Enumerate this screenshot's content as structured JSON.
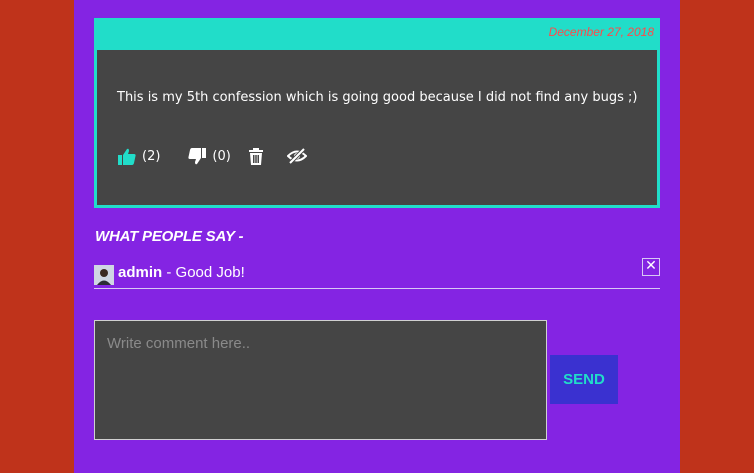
{
  "colors": {
    "page_bg": "#bf331b",
    "panel_bg": "#8424e3",
    "card_accent": "#21ddc9",
    "card_body": "#454545",
    "date_text": "#ff4a4a",
    "send_bg": "#3a31d0"
  },
  "confession": {
    "date": "December 27, 2018",
    "text": "This is my 5th confession which is going good because I did not find any bugs ;)",
    "likes": "(2)",
    "dislikes": "(0)",
    "icons": [
      "thumbs-up-icon",
      "thumbs-down-icon",
      "trash-icon",
      "eye-slash-icon"
    ]
  },
  "comments_section": {
    "title": "WHAT PEOPLE SAY -",
    "comments": [
      {
        "author": "admin",
        "separator": " - ",
        "text": "Good Job!"
      }
    ],
    "close_symbol": "✕"
  },
  "composer": {
    "placeholder": "Write comment here..",
    "value": "",
    "send_label": "SEND"
  }
}
